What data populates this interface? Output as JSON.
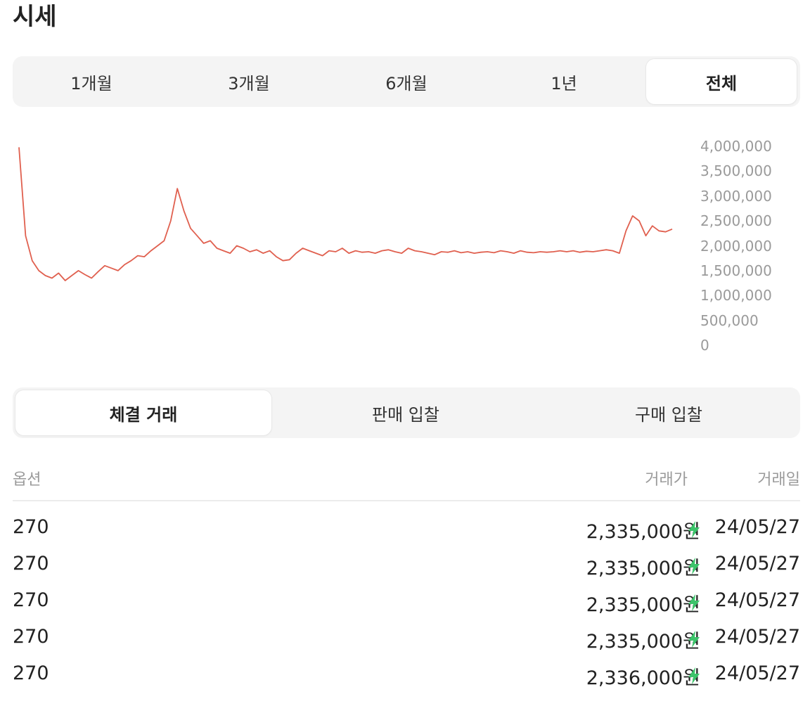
{
  "page": {
    "title": "시세"
  },
  "period_tabs": [
    {
      "label": "1개월",
      "active": false
    },
    {
      "label": "3개월",
      "active": false
    },
    {
      "label": "6개월",
      "active": false
    },
    {
      "label": "1년",
      "active": false
    },
    {
      "label": "전체",
      "active": true
    }
  ],
  "chart_data": {
    "type": "line",
    "title": "",
    "xlabel": "",
    "ylabel": "",
    "ylim": [
      0,
      4000000
    ],
    "y_ticks": [
      "4,000,000",
      "3,500,000",
      "3,000,000",
      "2,500,000",
      "2,000,000",
      "1,500,000",
      "1,000,000",
      "500,000",
      "0"
    ],
    "grid": false,
    "legend": "none",
    "series": [
      {
        "color": "#e0604f",
        "values": [
          3980000,
          2200000,
          1700000,
          1500000,
          1400000,
          1350000,
          1450000,
          1300000,
          1400000,
          1500000,
          1420000,
          1350000,
          1480000,
          1600000,
          1550000,
          1500000,
          1620000,
          1700000,
          1800000,
          1780000,
          1900000,
          2000000,
          2100000,
          2500000,
          3150000,
          2700000,
          2350000,
          2200000,
          2050000,
          2100000,
          1950000,
          1900000,
          1850000,
          2000000,
          1950000,
          1880000,
          1920000,
          1850000,
          1900000,
          1780000,
          1700000,
          1720000,
          1850000,
          1950000,
          1900000,
          1850000,
          1800000,
          1900000,
          1880000,
          1950000,
          1850000,
          1900000,
          1870000,
          1880000,
          1850000,
          1900000,
          1920000,
          1880000,
          1850000,
          1950000,
          1900000,
          1880000,
          1850000,
          1820000,
          1880000,
          1870000,
          1900000,
          1860000,
          1880000,
          1850000,
          1870000,
          1880000,
          1860000,
          1900000,
          1880000,
          1850000,
          1900000,
          1870000,
          1860000,
          1880000,
          1870000,
          1880000,
          1900000,
          1880000,
          1900000,
          1870000,
          1890000,
          1880000,
          1900000,
          1920000,
          1900000,
          1850000,
          2300000,
          2600000,
          2500000,
          2200000,
          2400000,
          2300000,
          2280000,
          2335000
        ]
      }
    ]
  },
  "trade_tabs": [
    {
      "label": "체결 거래",
      "active": true
    },
    {
      "label": "판매 입찰",
      "active": false
    },
    {
      "label": "구매 입찰",
      "active": false
    }
  ],
  "table": {
    "headers": {
      "option": "옵션",
      "price": "거래가",
      "date": "거래일"
    },
    "rows": [
      {
        "option": "270",
        "price": "2,335,000원",
        "date": "24/05/27",
        "icon": "lightning-icon",
        "icon_color": "#3cc36a"
      },
      {
        "option": "270",
        "price": "2,335,000원",
        "date": "24/05/27",
        "icon": "lightning-icon",
        "icon_color": "#3cc36a"
      },
      {
        "option": "270",
        "price": "2,335,000원",
        "date": "24/05/27",
        "icon": "lightning-icon",
        "icon_color": "#3cc36a"
      },
      {
        "option": "270",
        "price": "2,335,000원",
        "date": "24/05/27",
        "icon": "lightning-icon",
        "icon_color": "#3cc36a"
      },
      {
        "option": "270",
        "price": "2,336,000원",
        "date": "24/05/27",
        "icon": "lightning-icon",
        "icon_color": "#3cc36a"
      }
    ]
  }
}
